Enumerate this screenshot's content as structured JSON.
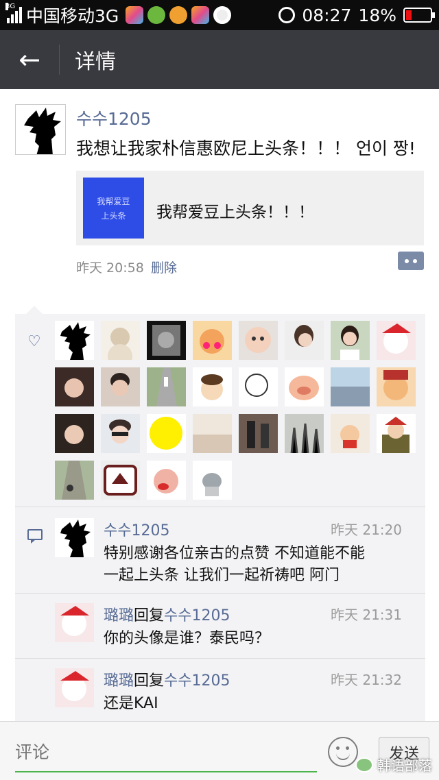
{
  "status_bar": {
    "network_small": "3G",
    "carrier": "中国移动3G",
    "time": "08:27",
    "battery": "18%"
  },
  "nav": {
    "back_icon": "←",
    "title": "详情"
  },
  "post": {
    "author": "수수1205",
    "text": "我想让我家朴信惠欧尼上头条！！！ 언이 짱!",
    "share": {
      "thumb_line1": "我帮爱豆",
      "thumb_line2": "上头条",
      "title": "我帮爱豆上头条！！！"
    },
    "time": "昨天 20:58",
    "delete": "删除"
  },
  "likes": {
    "icon": "heart-icon",
    "count": 28
  },
  "comments": [
    {
      "author": "수수1205",
      "time": "昨天 21:20",
      "lines": [
        "特别感谢各位亲古的点赞 不知道能不能",
        "一起上头条  让我们一起祈祷吧 阿门"
      ]
    },
    {
      "author": "璐璐",
      "reply_word": "回复",
      "reply_to": "수수1205",
      "time": "昨天 21:31",
      "lines": [
        "你的头像是谁？泰民吗？"
      ]
    },
    {
      "author": "璐璐",
      "reply_word": "回复",
      "reply_to": "수수1205",
      "time": "昨天 21:32",
      "lines": [
        "还是KAI"
      ]
    }
  ],
  "bottom": {
    "placeholder": "评论",
    "send": "发送",
    "watermark": "韩语部落"
  },
  "colors": {
    "link": "#576b95",
    "navbar": "#393a3f",
    "accent_green": "#4cb54c"
  }
}
